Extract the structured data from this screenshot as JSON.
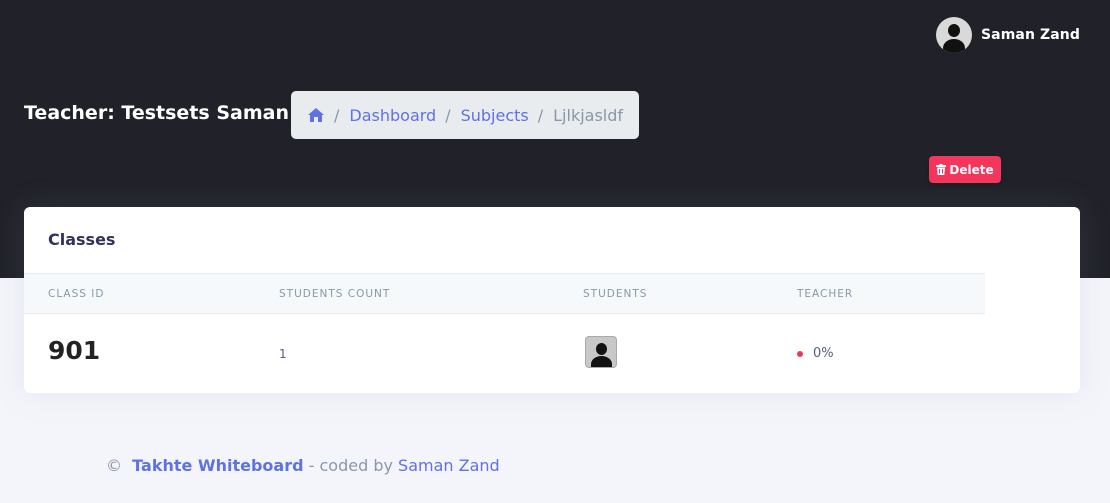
{
  "user": {
    "name": "Saman Zand"
  },
  "header": {
    "title": "Teacher: Testsets Saman"
  },
  "breadcrumb": {
    "icon": "home-icon",
    "items": [
      "Dashboard",
      "Subjects"
    ],
    "active": "Ljlkjasldf",
    "separator": "/"
  },
  "actions": {
    "delete_label": "Delete",
    "delete_icon": "trash-icon"
  },
  "card": {
    "title": "Classes",
    "columns": [
      "CLASS ID",
      "STUDENTS COUNT",
      "STUDENTS",
      "TEACHER"
    ],
    "rows": [
      {
        "class_id": "901",
        "students_count": "1",
        "teacher": "0%"
      }
    ]
  },
  "footer": {
    "copyright": "©",
    "brand": "Takhte Whiteboard",
    "coded_by": "- coded by",
    "author": "Saman Zand"
  },
  "colors": {
    "header_bg": "#212229",
    "accent": "#5e72e4",
    "danger": "#f5365c",
    "page_bg": "#f4f5fb"
  }
}
